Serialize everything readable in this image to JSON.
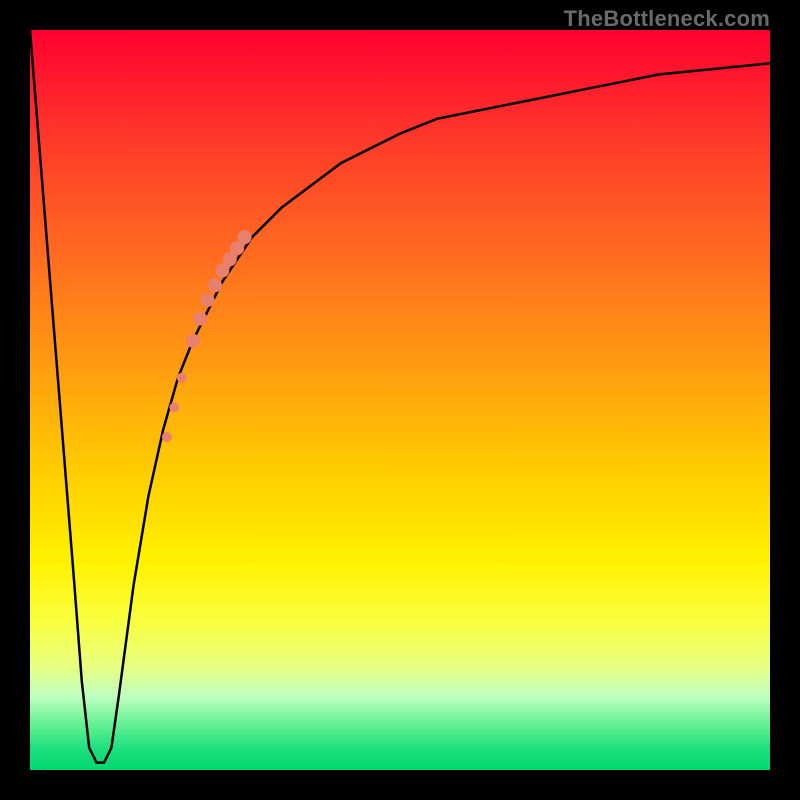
{
  "watermark": "TheBottleneck.com",
  "colors": {
    "frame": "#000000",
    "curve": "#000000",
    "marker": "#e88070",
    "gradient_top": "#ff0030",
    "gradient_bottom": "#00d870"
  },
  "chart_data": {
    "type": "line",
    "title": "",
    "xlabel": "",
    "ylabel": "",
    "xlim": [
      0,
      100
    ],
    "ylim": [
      0,
      100
    ],
    "x": [
      0,
      2,
      4,
      6,
      7,
      8,
      9,
      10,
      11,
      12,
      14,
      16,
      18,
      20,
      22,
      24,
      26,
      28,
      30,
      34,
      38,
      42,
      46,
      50,
      55,
      60,
      65,
      70,
      75,
      80,
      85,
      90,
      95,
      100
    ],
    "y": [
      100,
      75,
      50,
      25,
      12,
      3,
      1,
      1,
      3,
      10,
      25,
      37,
      46,
      53,
      58,
      62,
      66,
      69,
      72,
      76,
      79,
      82,
      84,
      86,
      88,
      89,
      90,
      91,
      92,
      93,
      94,
      94.5,
      95,
      95.5
    ],
    "markers": {
      "type": "scatter",
      "name": "highlighted-points",
      "color": "#e88070",
      "points": [
        {
          "x": 18.5,
          "y": 45,
          "r": 5
        },
        {
          "x": 19.5,
          "y": 49,
          "r": 5
        },
        {
          "x": 20.5,
          "y": 53,
          "r": 5
        },
        {
          "x": 22.0,
          "y": 58,
          "r": 7
        },
        {
          "x": 23.0,
          "y": 61,
          "r": 7
        },
        {
          "x": 24.0,
          "y": 63.5,
          "r": 7
        },
        {
          "x": 25.0,
          "y": 65.5,
          "r": 7
        },
        {
          "x": 26.0,
          "y": 67.5,
          "r": 7
        },
        {
          "x": 27.0,
          "y": 69,
          "r": 7
        },
        {
          "x": 28.0,
          "y": 70.5,
          "r": 7
        },
        {
          "x": 29.0,
          "y": 72,
          "r": 7
        }
      ]
    }
  }
}
